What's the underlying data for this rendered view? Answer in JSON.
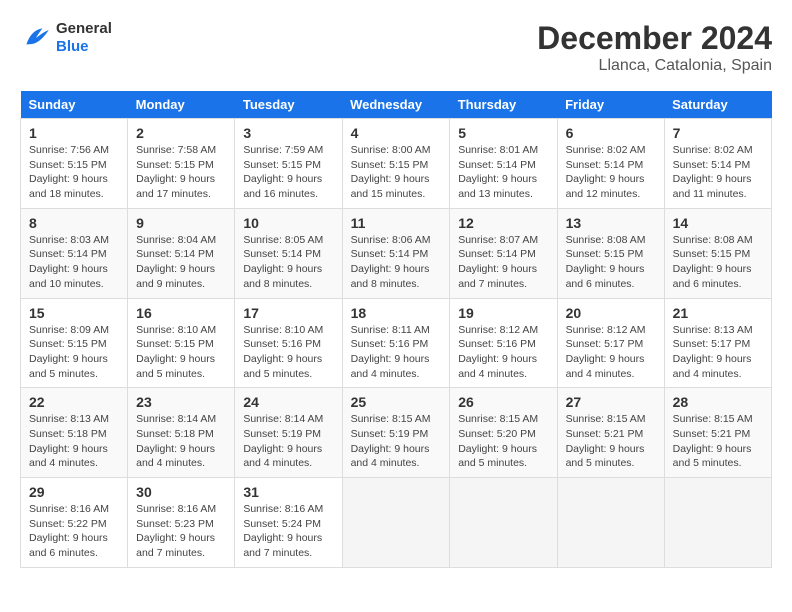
{
  "header": {
    "logo_text_general": "General",
    "logo_text_blue": "Blue",
    "month_title": "December 2024",
    "location": "Llanca, Catalonia, Spain"
  },
  "calendar": {
    "days_of_week": [
      "Sunday",
      "Monday",
      "Tuesday",
      "Wednesday",
      "Thursday",
      "Friday",
      "Saturday"
    ],
    "weeks": [
      [
        {
          "day": "1",
          "sunrise": "Sunrise: 7:56 AM",
          "sunset": "Sunset: 5:15 PM",
          "daylight": "Daylight: 9 hours and 18 minutes."
        },
        {
          "day": "2",
          "sunrise": "Sunrise: 7:58 AM",
          "sunset": "Sunset: 5:15 PM",
          "daylight": "Daylight: 9 hours and 17 minutes."
        },
        {
          "day": "3",
          "sunrise": "Sunrise: 7:59 AM",
          "sunset": "Sunset: 5:15 PM",
          "daylight": "Daylight: 9 hours and 16 minutes."
        },
        {
          "day": "4",
          "sunrise": "Sunrise: 8:00 AM",
          "sunset": "Sunset: 5:15 PM",
          "daylight": "Daylight: 9 hours and 15 minutes."
        },
        {
          "day": "5",
          "sunrise": "Sunrise: 8:01 AM",
          "sunset": "Sunset: 5:14 PM",
          "daylight": "Daylight: 9 hours and 13 minutes."
        },
        {
          "day": "6",
          "sunrise": "Sunrise: 8:02 AM",
          "sunset": "Sunset: 5:14 PM",
          "daylight": "Daylight: 9 hours and 12 minutes."
        },
        {
          "day": "7",
          "sunrise": "Sunrise: 8:02 AM",
          "sunset": "Sunset: 5:14 PM",
          "daylight": "Daylight: 9 hours and 11 minutes."
        }
      ],
      [
        {
          "day": "8",
          "sunrise": "Sunrise: 8:03 AM",
          "sunset": "Sunset: 5:14 PM",
          "daylight": "Daylight: 9 hours and 10 minutes."
        },
        {
          "day": "9",
          "sunrise": "Sunrise: 8:04 AM",
          "sunset": "Sunset: 5:14 PM",
          "daylight": "Daylight: 9 hours and 9 minutes."
        },
        {
          "day": "10",
          "sunrise": "Sunrise: 8:05 AM",
          "sunset": "Sunset: 5:14 PM",
          "daylight": "Daylight: 9 hours and 8 minutes."
        },
        {
          "day": "11",
          "sunrise": "Sunrise: 8:06 AM",
          "sunset": "Sunset: 5:14 PM",
          "daylight": "Daylight: 9 hours and 8 minutes."
        },
        {
          "day": "12",
          "sunrise": "Sunrise: 8:07 AM",
          "sunset": "Sunset: 5:14 PM",
          "daylight": "Daylight: 9 hours and 7 minutes."
        },
        {
          "day": "13",
          "sunrise": "Sunrise: 8:08 AM",
          "sunset": "Sunset: 5:15 PM",
          "daylight": "Daylight: 9 hours and 6 minutes."
        },
        {
          "day": "14",
          "sunrise": "Sunrise: 8:08 AM",
          "sunset": "Sunset: 5:15 PM",
          "daylight": "Daylight: 9 hours and 6 minutes."
        }
      ],
      [
        {
          "day": "15",
          "sunrise": "Sunrise: 8:09 AM",
          "sunset": "Sunset: 5:15 PM",
          "daylight": "Daylight: 9 hours and 5 minutes."
        },
        {
          "day": "16",
          "sunrise": "Sunrise: 8:10 AM",
          "sunset": "Sunset: 5:15 PM",
          "daylight": "Daylight: 9 hours and 5 minutes."
        },
        {
          "day": "17",
          "sunrise": "Sunrise: 8:10 AM",
          "sunset": "Sunset: 5:16 PM",
          "daylight": "Daylight: 9 hours and 5 minutes."
        },
        {
          "day": "18",
          "sunrise": "Sunrise: 8:11 AM",
          "sunset": "Sunset: 5:16 PM",
          "daylight": "Daylight: 9 hours and 4 minutes."
        },
        {
          "day": "19",
          "sunrise": "Sunrise: 8:12 AM",
          "sunset": "Sunset: 5:16 PM",
          "daylight": "Daylight: 9 hours and 4 minutes."
        },
        {
          "day": "20",
          "sunrise": "Sunrise: 8:12 AM",
          "sunset": "Sunset: 5:17 PM",
          "daylight": "Daylight: 9 hours and 4 minutes."
        },
        {
          "day": "21",
          "sunrise": "Sunrise: 8:13 AM",
          "sunset": "Sunset: 5:17 PM",
          "daylight": "Daylight: 9 hours and 4 minutes."
        }
      ],
      [
        {
          "day": "22",
          "sunrise": "Sunrise: 8:13 AM",
          "sunset": "Sunset: 5:18 PM",
          "daylight": "Daylight: 9 hours and 4 minutes."
        },
        {
          "day": "23",
          "sunrise": "Sunrise: 8:14 AM",
          "sunset": "Sunset: 5:18 PM",
          "daylight": "Daylight: 9 hours and 4 minutes."
        },
        {
          "day": "24",
          "sunrise": "Sunrise: 8:14 AM",
          "sunset": "Sunset: 5:19 PM",
          "daylight": "Daylight: 9 hours and 4 minutes."
        },
        {
          "day": "25",
          "sunrise": "Sunrise: 8:15 AM",
          "sunset": "Sunset: 5:19 PM",
          "daylight": "Daylight: 9 hours and 4 minutes."
        },
        {
          "day": "26",
          "sunrise": "Sunrise: 8:15 AM",
          "sunset": "Sunset: 5:20 PM",
          "daylight": "Daylight: 9 hours and 5 minutes."
        },
        {
          "day": "27",
          "sunrise": "Sunrise: 8:15 AM",
          "sunset": "Sunset: 5:21 PM",
          "daylight": "Daylight: 9 hours and 5 minutes."
        },
        {
          "day": "28",
          "sunrise": "Sunrise: 8:15 AM",
          "sunset": "Sunset: 5:21 PM",
          "daylight": "Daylight: 9 hours and 5 minutes."
        }
      ],
      [
        {
          "day": "29",
          "sunrise": "Sunrise: 8:16 AM",
          "sunset": "Sunset: 5:22 PM",
          "daylight": "Daylight: 9 hours and 6 minutes."
        },
        {
          "day": "30",
          "sunrise": "Sunrise: 8:16 AM",
          "sunset": "Sunset: 5:23 PM",
          "daylight": "Daylight: 9 hours and 7 minutes."
        },
        {
          "day": "31",
          "sunrise": "Sunrise: 8:16 AM",
          "sunset": "Sunset: 5:24 PM",
          "daylight": "Daylight: 9 hours and 7 minutes."
        },
        null,
        null,
        null,
        null
      ]
    ]
  }
}
